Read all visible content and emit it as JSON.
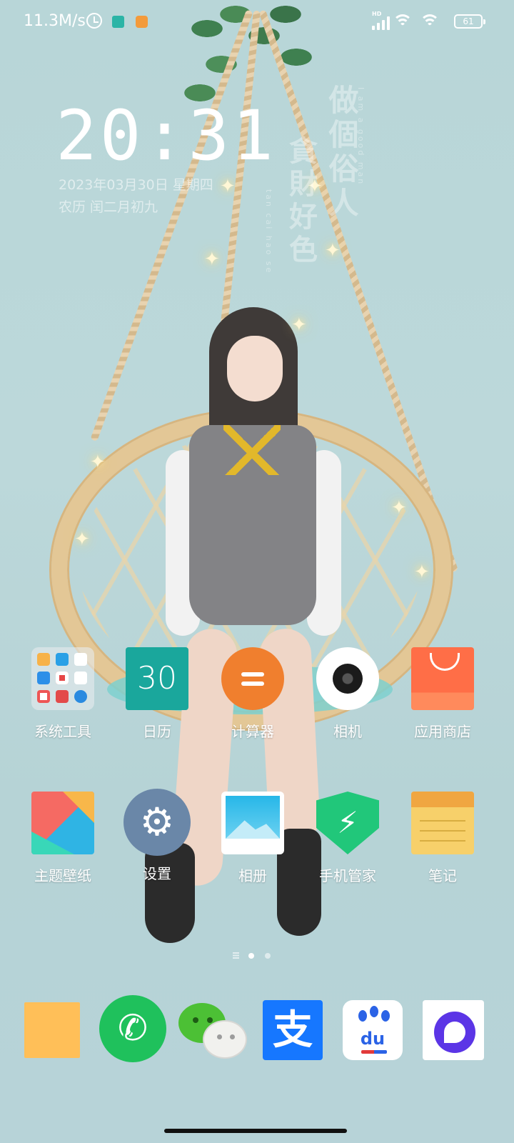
{
  "status_bar": {
    "net_speed": "11.3M/s",
    "network_label": "HD",
    "battery": "61"
  },
  "clock_widget": {
    "time": "20:31",
    "date": "2023年03月30日 星期四",
    "lunar": "农历 闰二月初九"
  },
  "wallpaper": {
    "poem_main": "做個俗人",
    "poem_second": "貪財好色",
    "poem_english_1": "I am a good man",
    "poem_english_2": "tan cai hao se"
  },
  "apps_row1": [
    {
      "label": "系统工具",
      "icon": "folder-icon"
    },
    {
      "label": "日历",
      "icon": "calendar-icon",
      "day": "30"
    },
    {
      "label": "计算器",
      "icon": "calculator-icon"
    },
    {
      "label": "相机",
      "icon": "camera-icon"
    },
    {
      "label": "应用商店",
      "icon": "app-store-icon"
    }
  ],
  "apps_row2": [
    {
      "label": "主题壁纸",
      "icon": "themes-icon"
    },
    {
      "label": "设置",
      "icon": "settings-icon"
    },
    {
      "label": "相册",
      "icon": "gallery-icon"
    },
    {
      "label": "手机管家",
      "icon": "security-icon"
    },
    {
      "label": "笔记",
      "icon": "notes-icon"
    }
  ],
  "pager": {
    "current": 2,
    "total": 3
  },
  "dock": [
    {
      "icon": "messages-icon"
    },
    {
      "icon": "phone-icon"
    },
    {
      "icon": "wechat-icon"
    },
    {
      "icon": "alipay-icon"
    },
    {
      "icon": "baidu-icon",
      "text": "du"
    },
    {
      "icon": "quark-browser-icon"
    }
  ],
  "colors": {
    "wallpaper_bg": "#b8d6d8",
    "calendar": "#1aa79c",
    "calculator": "#f07f2e",
    "app_store": "#ff6e47",
    "settings": "#6a87a8",
    "security": "#21c77a",
    "phone": "#1fc15c",
    "alipay": "#1677ff"
  }
}
